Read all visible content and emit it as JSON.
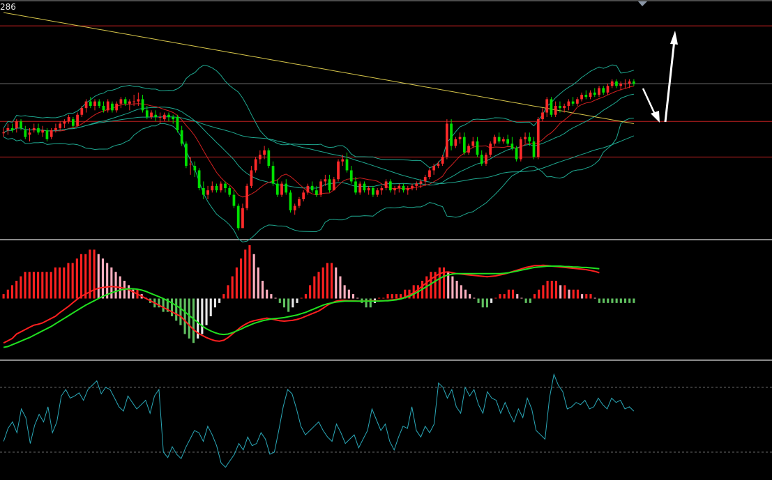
{
  "price_label": "286",
  "chart_data": {
    "type": "candlestick",
    "colors": {
      "background": "#000000",
      "up": "#ff2a2a",
      "down": "#00e000",
      "ma_yellow": "#d6c54a",
      "ma_red": "#d02020",
      "boll": "#1fa890",
      "macd_dif": "#ff2020",
      "macd_dea": "#20e020",
      "hist_up_strong": "#ff2020",
      "hist_up_weak": "#ffb0c0",
      "hist_dn_strong": "#60c060",
      "hist_dn_weak": "#e8e8e8",
      "osc": "#2aa8b8",
      "hline_red": "#c02020",
      "hline_gray": "#707070",
      "arrow": "#ffffff"
    },
    "price_panel": {
      "ylim": [
        0,
        100
      ],
      "horizontal_lines": [
        {
          "y": 94,
          "color": "hline_red"
        },
        {
          "y": 68,
          "color": "hline_gray"
        },
        {
          "y": 51,
          "color": "hline_red"
        },
        {
          "y": 35,
          "color": "hline_red"
        }
      ],
      "candles_ohlc": [
        [
          46,
          48,
          44,
          46
        ],
        [
          47,
          50,
          45,
          48
        ],
        [
          48,
          50,
          46,
          47
        ],
        [
          48,
          52,
          46,
          51
        ],
        [
          51,
          52,
          47,
          48
        ],
        [
          47,
          49,
          43,
          44
        ],
        [
          45,
          48,
          42,
          46
        ],
        [
          47,
          50,
          46,
          48
        ],
        [
          48,
          50,
          45,
          46
        ],
        [
          46,
          49,
          44,
          47
        ],
        [
          47,
          48,
          42,
          43
        ],
        [
          44,
          48,
          43,
          47
        ],
        [
          47,
          50,
          46,
          48
        ],
        [
          48,
          51,
          47,
          50
        ],
        [
          50,
          52,
          48,
          51
        ],
        [
          51,
          54,
          50,
          53
        ],
        [
          52,
          53,
          48,
          49
        ],
        [
          49,
          55,
          49,
          54
        ],
        [
          54,
          58,
          53,
          57
        ],
        [
          57,
          61,
          55,
          60
        ],
        [
          60,
          62,
          57,
          58
        ],
        [
          58,
          61,
          56,
          60
        ],
        [
          60,
          61,
          57,
          58
        ],
        [
          58,
          60,
          55,
          56
        ],
        [
          56,
          61,
          55,
          60
        ],
        [
          59,
          60,
          55,
          56
        ],
        [
          56,
          60,
          55,
          59
        ],
        [
          59,
          62,
          57,
          61
        ],
        [
          61,
          62,
          58,
          59
        ],
        [
          59,
          61,
          56,
          60
        ],
        [
          60,
          63,
          58,
          60
        ],
        [
          60,
          64,
          58,
          61
        ],
        [
          61,
          63,
          55,
          56
        ],
        [
          56,
          58,
          52,
          53
        ],
        [
          53,
          56,
          52,
          55
        ],
        [
          54,
          56,
          51,
          53
        ],
        [
          53,
          55,
          50,
          53
        ],
        [
          52,
          55,
          51,
          54
        ],
        [
          54,
          55,
          51,
          53
        ],
        [
          53,
          54,
          50,
          52
        ],
        [
          53,
          54,
          46,
          47
        ],
        [
          47,
          49,
          40,
          41
        ],
        [
          41,
          42,
          30,
          31
        ],
        [
          32,
          35,
          27,
          32
        ],
        [
          31,
          33,
          26,
          29
        ],
        [
          29,
          30,
          20,
          21
        ],
        [
          21,
          24,
          16,
          18
        ],
        [
          18,
          22,
          16,
          20
        ],
        [
          20,
          24,
          19,
          22
        ],
        [
          22,
          23,
          19,
          20
        ],
        [
          20,
          24,
          19,
          23
        ],
        [
          23,
          24,
          19,
          21
        ],
        [
          21,
          22,
          17,
          18
        ],
        [
          18,
          20,
          12,
          13
        ],
        [
          13,
          14,
          2,
          3
        ],
        [
          3,
          14,
          3,
          12
        ],
        [
          12,
          23,
          11,
          22
        ],
        [
          22,
          31,
          21,
          29
        ],
        [
          29,
          35,
          28,
          34
        ],
        [
          34,
          38,
          32,
          36
        ],
        [
          36,
          40,
          34,
          38
        ],
        [
          38,
          39,
          30,
          31
        ],
        [
          31,
          33,
          22,
          23
        ],
        [
          23,
          25,
          17,
          18
        ],
        [
          18,
          24,
          17,
          23
        ],
        [
          23,
          25,
          18,
          19
        ],
        [
          19,
          20,
          10,
          11
        ],
        [
          11,
          14,
          9,
          13
        ],
        [
          13,
          17,
          12,
          16
        ],
        [
          16,
          20,
          15,
          19
        ],
        [
          19,
          23,
          18,
          22
        ],
        [
          22,
          24,
          19,
          20
        ],
        [
          20,
          22,
          17,
          18
        ],
        [
          18,
          25,
          17,
          24
        ],
        [
          24,
          27,
          22,
          25
        ],
        [
          25,
          27,
          19,
          20
        ],
        [
          20,
          26,
          20,
          25
        ],
        [
          25,
          34,
          24,
          33
        ],
        [
          33,
          36,
          31,
          34
        ],
        [
          34,
          37,
          28,
          29
        ],
        [
          29,
          31,
          23,
          24
        ],
        [
          24,
          26,
          18,
          19
        ],
        [
          19,
          24,
          18,
          23
        ],
        [
          23,
          24,
          19,
          20
        ],
        [
          20,
          22,
          18,
          21
        ],
        [
          21,
          22,
          17,
          18
        ],
        [
          18,
          21,
          17,
          20
        ],
        [
          20,
          22,
          18,
          21
        ],
        [
          21,
          25,
          20,
          24
        ],
        [
          24,
          25,
          19,
          20
        ],
        [
          20,
          22,
          18,
          21
        ],
        [
          21,
          23,
          19,
          22
        ],
        [
          22,
          23,
          19,
          20
        ],
        [
          20,
          22,
          18,
          21
        ],
        [
          21,
          23,
          20,
          22
        ],
        [
          22,
          24,
          20,
          23
        ],
        [
          23,
          25,
          21,
          24
        ],
        [
          24,
          27,
          22,
          26
        ],
        [
          26,
          30,
          25,
          29
        ],
        [
          29,
          32,
          27,
          31
        ],
        [
          31,
          33,
          30,
          32
        ],
        [
          32,
          36,
          31,
          35
        ],
        [
          35,
          52,
          34,
          50
        ],
        [
          50,
          52,
          38,
          40
        ],
        [
          40,
          44,
          39,
          43
        ],
        [
          43,
          46,
          41,
          44
        ],
        [
          44,
          46,
          36,
          37
        ],
        [
          37,
          41,
          36,
          40
        ],
        [
          40,
          44,
          39,
          42
        ],
        [
          42,
          44,
          35,
          36
        ],
        [
          36,
          38,
          31,
          32
        ],
        [
          32,
          37,
          31,
          36
        ],
        [
          36,
          42,
          35,
          41
        ],
        [
          41,
          45,
          40,
          44
        ],
        [
          44,
          46,
          41,
          42
        ],
        [
          42,
          44,
          41,
          43
        ],
        [
          43,
          45,
          40,
          41
        ],
        [
          41,
          44,
          38,
          39
        ],
        [
          39,
          40,
          33,
          34
        ],
        [
          34,
          44,
          33,
          43
        ],
        [
          43,
          46,
          41,
          44
        ],
        [
          44,
          46,
          40,
          42
        ],
        [
          42,
          44,
          34,
          35
        ],
        [
          35,
          53,
          34,
          52
        ],
        [
          52,
          57,
          51,
          55
        ],
        [
          55,
          62,
          53,
          61
        ],
        [
          61,
          62,
          53,
          54
        ],
        [
          54,
          60,
          53,
          58
        ],
        [
          58,
          60,
          55,
          57
        ],
        [
          57,
          59,
          55,
          58
        ],
        [
          58,
          61,
          56,
          60
        ],
        [
          60,
          62,
          58,
          59
        ],
        [
          59,
          62,
          58,
          61
        ],
        [
          61,
          64,
          60,
          63
        ],
        [
          63,
          65,
          61,
          62
        ],
        [
          62,
          65,
          61,
          64
        ],
        [
          64,
          66,
          62,
          63
        ],
        [
          63,
          67,
          62,
          66
        ],
        [
          66,
          67,
          63,
          64
        ],
        [
          64,
          68,
          63,
          67
        ],
        [
          67,
          70,
          66,
          69
        ],
        [
          69,
          70,
          66,
          67
        ],
        [
          67,
          69,
          65,
          68
        ],
        [
          68,
          70,
          66,
          68
        ],
        [
          68,
          70,
          66,
          69
        ],
        [
          69,
          70,
          67,
          68
        ]
      ]
    },
    "macd_panel": {
      "ylim": [
        -12,
        12
      ],
      "histogram": [
        1,
        2,
        3,
        4,
        5,
        6,
        6,
        6,
        6,
        6,
        6,
        6,
        7,
        7,
        7,
        8,
        8,
        9,
        10,
        10,
        11,
        11,
        10,
        9,
        8,
        7,
        6,
        5,
        4,
        3,
        2,
        2,
        1,
        0,
        -1,
        -2,
        -2,
        -3,
        -3,
        -4,
        -5,
        -6,
        -8,
        -9,
        -10,
        -9,
        -8,
        -6,
        -4,
        -2,
        -1,
        1,
        3,
        5,
        7,
        9,
        11,
        12,
        10,
        7,
        4,
        2,
        1,
        0,
        -1,
        -2,
        -3,
        -2,
        -1,
        0,
        1,
        3,
        5,
        6,
        7,
        8,
        8,
        7,
        5,
        3,
        2,
        1,
        0,
        -1,
        -2,
        -2,
        -1,
        0,
        0,
        1,
        1,
        1,
        1,
        2,
        2,
        3,
        3,
        4,
        5,
        6,
        6,
        7,
        7,
        6,
        5,
        4,
        3,
        2,
        1,
        0,
        -1,
        -2,
        -2,
        -1,
        0,
        1,
        1,
        2,
        2,
        1,
        0,
        -1,
        -1,
        1,
        2,
        3,
        4,
        4,
        4,
        3,
        3,
        2,
        2,
        2,
        1,
        1,
        1,
        0,
        -1,
        -1,
        -1,
        -1,
        -1,
        -1,
        -1,
        -1,
        -1
      ],
      "dif": [
        -10,
        -9.5,
        -9,
        -8,
        -7.5,
        -7,
        -6.5,
        -6,
        -5.8,
        -5.5,
        -5,
        -4.5,
        -4,
        -3.2,
        -2.5,
        -1.8,
        -1,
        -0.2,
        0.5,
        1,
        1.5,
        2,
        2.3,
        2.5,
        2.6,
        2.7,
        2.6,
        2.5,
        2.3,
        2,
        1.5,
        1,
        0.5,
        0,
        -0.5,
        -1,
        -1.5,
        -2,
        -2.5,
        -3,
        -3.5,
        -4,
        -5,
        -6,
        -7,
        -7.8,
        -8.3,
        -8.8,
        -9.2,
        -9.5,
        -9.6,
        -9.4,
        -8.8,
        -8,
        -7.2,
        -6.4,
        -5.8,
        -5.3,
        -5,
        -4.8,
        -4.6,
        -4.4,
        -4.6,
        -4.8,
        -5,
        -5.1,
        -5,
        -4.9,
        -4.7,
        -4.4,
        -4,
        -3.6,
        -3.2,
        -2.8,
        -2.2,
        -1.5,
        -1,
        -0.6,
        -0.4,
        -0.4,
        -0.5,
        -0.5,
        -0.6,
        -0.6,
        -0.6,
        -0.5,
        -0.5,
        -0.5,
        -0.5,
        -0.4,
        -0.3,
        -0.2,
        0,
        0.3,
        0.8,
        1.3,
        2,
        2.8,
        3.6,
        4.4,
        5,
        5.6,
        5.9,
        6,
        5.8,
        5.6,
        5.5,
        5.4,
        5.3,
        5.2,
        5.1,
        5,
        4.9,
        5,
        5.1,
        5.3,
        5.5,
        5.8,
        6.1,
        6.4,
        6.7,
        7,
        7.2,
        7.4,
        7.4,
        7.5,
        7.4,
        7.3,
        7.2,
        7.1,
        7,
        6.9,
        6.8,
        6.7,
        6.6,
        6.5,
        6.3,
        6.1,
        5.8
      ],
      "dea": [
        -11,
        -10.8,
        -10.4,
        -10,
        -9.6,
        -9.2,
        -8.8,
        -8.3,
        -7.8,
        -7.3,
        -6.8,
        -6.3,
        -5.7,
        -5.1,
        -4.5,
        -3.9,
        -3.3,
        -2.7,
        -2.1,
        -1.5,
        -1,
        -0.5,
        0,
        0.5,
        0.9,
        1.3,
        1.6,
        1.9,
        2.1,
        2.2,
        2.2,
        2.1,
        1.9,
        1.6,
        1.2,
        0.8,
        0.4,
        0,
        -0.5,
        -1,
        -1.6,
        -2.2,
        -3,
        -3.8,
        -4.6,
        -5.4,
        -6.2,
        -6.8,
        -7.3,
        -7.7,
        -8,
        -8.1,
        -8,
        -7.7,
        -7.3,
        -6.9,
        -6.4,
        -6,
        -5.6,
        -5.3,
        -5,
        -4.8,
        -4.6,
        -4.5,
        -4.4,
        -4.3,
        -4.1,
        -3.9,
        -3.7,
        -3.4,
        -3.1,
        -2.7,
        -2.3,
        -1.9,
        -1.5,
        -1.2,
        -1,
        -0.8,
        -0.7,
        -0.6,
        -0.6,
        -0.6,
        -0.6,
        -0.6,
        -0.6,
        -0.6,
        -0.6,
        -0.6,
        -0.5,
        -0.5,
        -0.4,
        -0.3,
        -0.1,
        0.2,
        0.5,
        1,
        1.5,
        2.1,
        2.7,
        3.3,
        3.9,
        4.5,
        5,
        5.3,
        5.5,
        5.6,
        5.6,
        5.6,
        5.6,
        5.6,
        5.6,
        5.6,
        5.6,
        5.6,
        5.6,
        5.6,
        5.7,
        5.8,
        6,
        6.2,
        6.4,
        6.6,
        6.8,
        7,
        7.1,
        7.2,
        7.3,
        7.3,
        7.3,
        7.3,
        7.2,
        7.2,
        7.1,
        7.1,
        7.0,
        7.0,
        6.9,
        6.8,
        6.7
      ]
    },
    "osc_panel": {
      "ylim": [
        0,
        100
      ],
      "dashed_levels": [
        80,
        20
      ],
      "values": [
        30,
        42,
        48,
        38,
        60,
        52,
        28,
        45,
        55,
        48,
        62,
        38,
        48,
        72,
        78,
        70,
        72,
        75,
        68,
        78,
        82,
        86,
        74,
        80,
        78,
        70,
        62,
        58,
        72,
        66,
        60,
        64,
        68,
        56,
        72,
        78,
        20,
        15,
        25,
        18,
        14,
        24,
        32,
        40,
        38,
        30,
        44,
        36,
        26,
        10,
        6,
        12,
        18,
        28,
        22,
        34,
        26,
        28,
        38,
        32,
        18,
        20,
        40,
        62,
        78,
        74,
        60,
        44,
        36,
        40,
        44,
        48,
        40,
        34,
        30,
        46,
        38,
        28,
        32,
        36,
        24,
        32,
        40,
        60,
        50,
        40,
        46,
        30,
        22,
        34,
        44,
        42,
        62,
        40,
        34,
        44,
        38,
        46,
        84,
        80,
        70,
        78,
        62,
        56,
        80,
        72,
        78,
        64,
        56,
        76,
        70,
        68,
        56,
        66,
        56,
        48,
        60,
        52,
        70,
        60,
        40,
        36,
        32,
        70,
        92,
        82,
        76,
        60,
        62,
        66,
        64,
        68,
        60,
        62,
        70,
        64,
        60,
        70,
        66,
        68,
        60,
        62,
        58
      ]
    },
    "arrows": [
      {
        "type": "down",
        "note": ""
      },
      {
        "type": "up",
        "note": ""
      }
    ]
  }
}
